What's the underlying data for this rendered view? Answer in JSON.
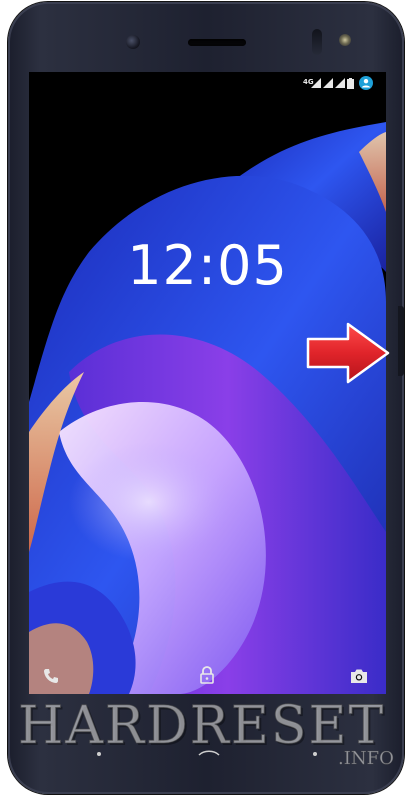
{
  "lockscreen": {
    "time": "12:05"
  },
  "status_bar": {
    "network_label": "4G",
    "icons": [
      "wifi-icon",
      "signal-icon",
      "signal-icon",
      "battery-icon",
      "account-icon"
    ]
  },
  "shortcuts": {
    "left": "phone-icon",
    "center": "lock-icon",
    "right": "camera-icon"
  },
  "watermark": {
    "main": "HARDRESET",
    "sub": ".INFO"
  },
  "annotation": {
    "arrow_color": "#e0242a",
    "points_to": "power-button"
  },
  "colors": {
    "device_body": "#1e2130",
    "accent_blue": "#2a44e6",
    "accent_purple": "#7b2fd0",
    "accent_orange": "#f0a25a"
  }
}
